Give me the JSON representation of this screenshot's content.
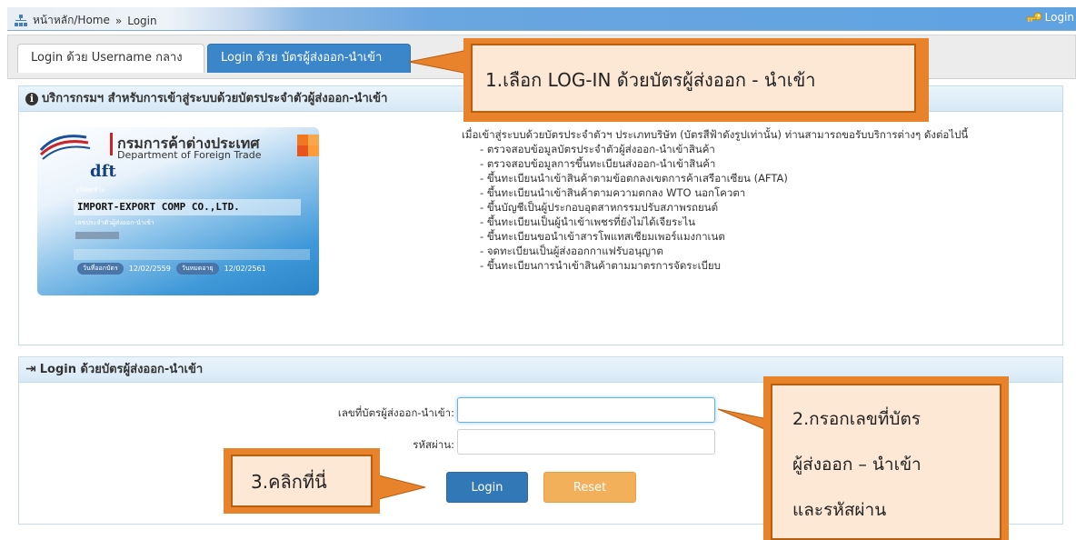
{
  "breadcrumb": {
    "home": "หน้าหลัก/Home",
    "separator": "»",
    "current": "Login"
  },
  "topbar": {
    "login_label": "Login"
  },
  "tabs": [
    {
      "label": "Login ด้วย Username กลาง",
      "active": false
    },
    {
      "label": "Login ด้วย บัตรผู้ส่งออก-นำเข้า",
      "active": true
    }
  ],
  "services_panel": {
    "title": "บริการกรมฯ สำหรับการเข้าสู่ระบบด้วยบัตรประจำตัวผู้ส่งออก-นำเข้า",
    "intro": "เมื่อเข้าสู่ระบบด้วยบัตรประจำตัวฯ ประเภทบริษัท (บัตรสีฟ้าดังรูปเท่านั้น) ท่านสามารถขอรับบริการต่างๆ ดังต่อไปนี้",
    "items": [
      "ตรวจสอบข้อมูลบัตรประจำตัวผู้ส่งออก-นำเข้าสินค้า",
      "ตรวจสอบข้อมูลการขึ้นทะเบียนส่งออก-นำเข้าสินค้า",
      "ขึ้นทะเบียนนำเข้าสินค้าตามข้อตกลงเขตการค้าเสรีอาเซียน (AFTA)",
      "ขึ้นทะเบียนนำเข้าสินค้าตามความตกลง WTO นอกโควตา",
      "ขึ้นบัญชีเป็นผู้ประกอบอุตสาหกรรมปรับสภาพรถยนต์",
      "ขึ้นทะเบียนเป็นผู้นำเข้าเพชรที่ยังไม่ได้เจียระไน",
      "ขึ้นทะเบียนขอนำเข้าสารโพแทสเซียมเพอร์แมงกาเนต",
      "จดทะเบียนเป็นผู้ส่งออกกาแฟรับอนุญาต",
      "ขึ้นทะเบียนการนำเข้าสินค้าตามมาตรการจัดระเบียบ"
    ]
  },
  "card": {
    "org_th": "กรมการค้าต่างประเทศ",
    "org_en": "Department of Foreign Trade",
    "logo_text": "dft",
    "company_label": "บริษัท/ห้าง",
    "company_name": "IMPORT-EXPORT COMP CO.,LTD.",
    "id_label": "เลขประจำตัวผู้ส่งออก-นำเข้า",
    "issue_label": "วันที่ออกบัตร",
    "issue_date": "12/02/2559",
    "expiry_label": "วันหมดอายุ",
    "expiry_date": "12/02/2561"
  },
  "login_panel": {
    "title": "Login ด้วยบัตรผู้ส่งออก-นำเข้า",
    "card_no_label": "เลขที่บัตรผู้ส่งออก-นำเข้า:",
    "card_no_value": "",
    "password_label": "รหัสผ่าน:",
    "password_value": "",
    "login_button": "Login",
    "reset_button": "Reset"
  },
  "callouts": {
    "step1": "1.เลือก LOG-IN ด้วยบัตรผู้ส่งออก - นำเข้า",
    "step2_line1": "2.กรอกเลขที่บัตร",
    "step2_line2": "ผู้ส่งออก – นำเข้า",
    "step2_line3": "และรหัสผ่าน",
    "step3": "3.คลิกที่นี่"
  },
  "colors": {
    "tab_active": "#3a86c8",
    "login_button": "#3278b6",
    "reset_button": "#f2b05b",
    "callout_fill": "#fde8d6",
    "callout_border": "#e8832c"
  }
}
